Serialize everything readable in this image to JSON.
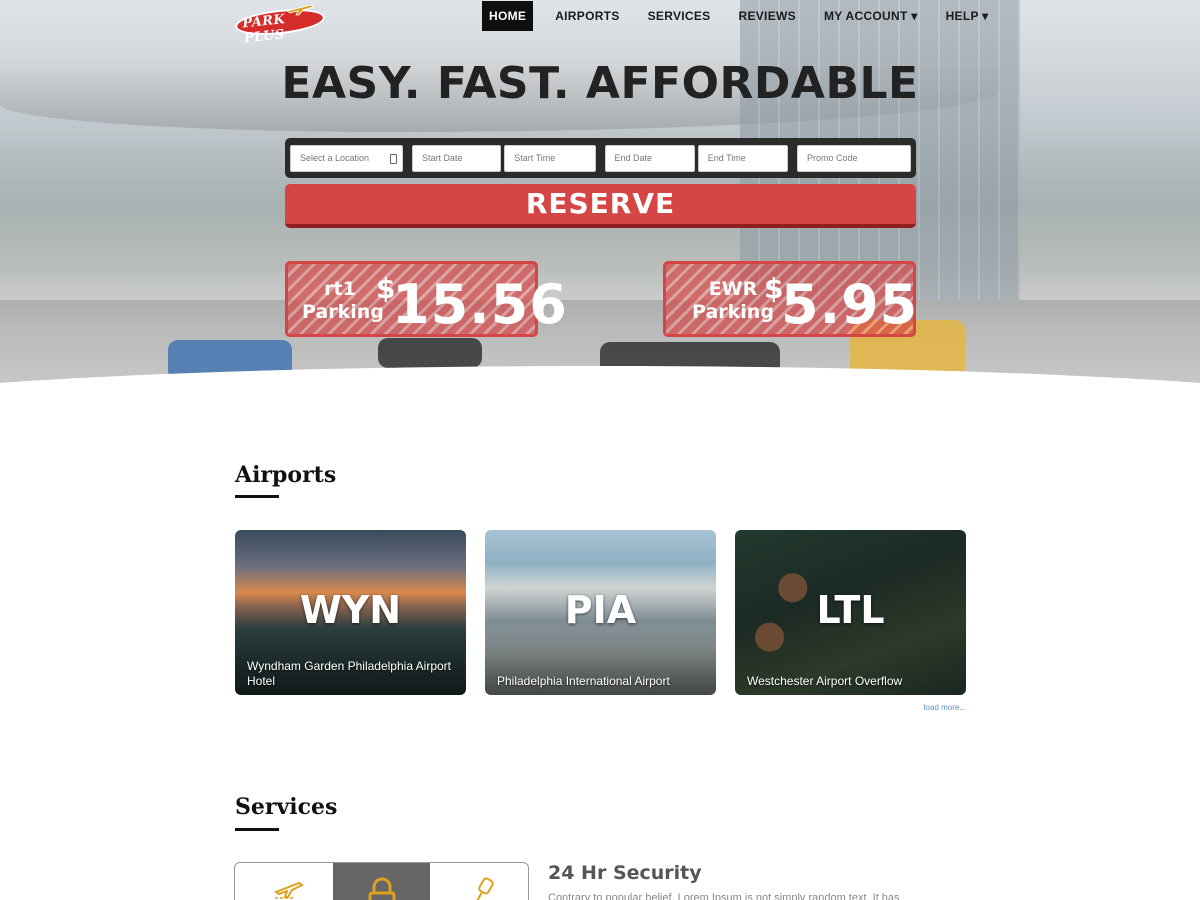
{
  "brand": {
    "logo_text": "PARK PLUS"
  },
  "nav": {
    "items": [
      {
        "label": "HOME",
        "active": true
      },
      {
        "label": "AIRPORTS"
      },
      {
        "label": "SERVICES"
      },
      {
        "label": "REVIEWS"
      },
      {
        "label": "MY ACCOUNT ▾"
      },
      {
        "label": "HELP ▾"
      }
    ]
  },
  "hero": {
    "headline": "EASY. FAST. AFFORDABLE",
    "fields": {
      "location": "Select a Location",
      "start_date": "Start Date",
      "start_time": "Start Time",
      "end_date": "End Date",
      "end_time": "End Time",
      "promo_code": "Promo Code"
    },
    "reserve_label": "RESERVE",
    "promos": [
      {
        "code": "rt1",
        "label": "Parking",
        "currency": "$",
        "price": "15.56"
      },
      {
        "code": "EWR",
        "label": "Parking",
        "currency": "$",
        "price": "5.95"
      }
    ]
  },
  "airports": {
    "title": "Airports",
    "cards": [
      {
        "code": "WYN",
        "name": "Wyndham Garden Philadelphia Airport Hotel"
      },
      {
        "code": "PIA",
        "name": "Philadelphia International Airport"
      },
      {
        "code": "LTL",
        "name": "Westchester Airport Overflow"
      }
    ],
    "load_more": "load more..."
  },
  "services": {
    "title": "Services",
    "tabs": [
      {
        "icon": "airplane-icon"
      },
      {
        "icon": "lock-icon"
      },
      {
        "icon": "key-icon"
      }
    ],
    "heading": "24 Hr Security",
    "body": "Contrary to popular belief, Lorem Ipsum is not simply random text. It has"
  },
  "colors": {
    "accent": "#d64545",
    "nav_active": "#0f0f0f",
    "icon": "#e0a020"
  }
}
